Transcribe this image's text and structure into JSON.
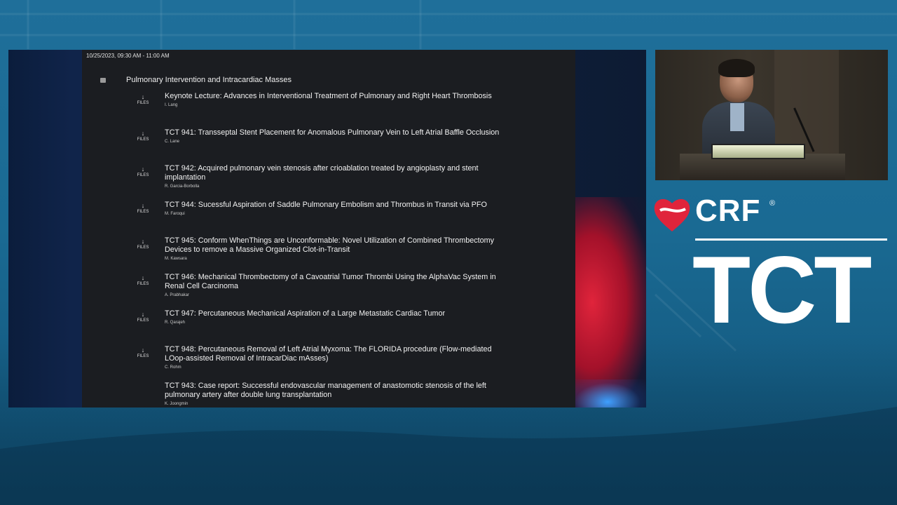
{
  "session": {
    "datetime": "10/25/2023, 09:30 AM - 11:00 AM",
    "title": "Pulmonary Intervention and Intracardiac Masses"
  },
  "files_label": "FILES",
  "files_arrow": "↓",
  "items": [
    {
      "title": "Keynote Lecture: Advances in Interventional Treatment of Pulmonary and Right Heart Thrombosis",
      "author": "I. Lang",
      "has_files": true
    },
    {
      "title": "TCT 941: Transseptal Stent Placement for Anomalous Pulmonary Vein to Left Atrial Baffle Occlusion",
      "author": "C. Lane",
      "has_files": true
    },
    {
      "title": "TCT 942: Acquired pulmonary vein stenosis after crioablation treated by angioplasty and stent implantation",
      "author": "R. Garcia-Borbolla",
      "has_files": true
    },
    {
      "title": "TCT 944: Sucessful Aspiration of Saddle Pulmonary Embolism and Thrombus in Transit via PFO",
      "author": "M. Faroqui",
      "has_files": true
    },
    {
      "title": "TCT 945: Conform WhenThings are Unconformable: Novel Utilization of Combined Thrombectomy Devices to remove a Massive Organized Clot-in-Transit",
      "author": "M. Kawsara",
      "has_files": true
    },
    {
      "title": "TCT 946: Mechanical Thrombectomy of a Cavoatrial Tumor Thrombi Using the AlphaVac System in Renal Cell Carcinoma",
      "author": "A. Prabhakar",
      "has_files": true
    },
    {
      "title": "TCT 947: Percutaneous Mechanical Aspiration of a Large Metastatic Cardiac Tumor",
      "author": "R. Qarajeh",
      "has_files": true
    },
    {
      "title": "TCT 948: Percutaneous Removal of Left Atrial Myxoma: The FLORIDA procedure (Flow-mediated LOop-assisted Removal of IntracarDiac mAsses)",
      "author": "C. Rohm",
      "has_files": true
    },
    {
      "title": "TCT 943: Case report: Successful endovascular management of anastomotic stenosis of the left pulmonary artery after double lung transplantation",
      "author": "K. Joongmin",
      "has_files": false
    }
  ],
  "logo": {
    "crf": "CRF",
    "registered": "®",
    "tct": "TCT"
  },
  "colors": {
    "background": "#1f6f9a",
    "panel": "#1b1d21",
    "brand_red": "#e0243b"
  }
}
